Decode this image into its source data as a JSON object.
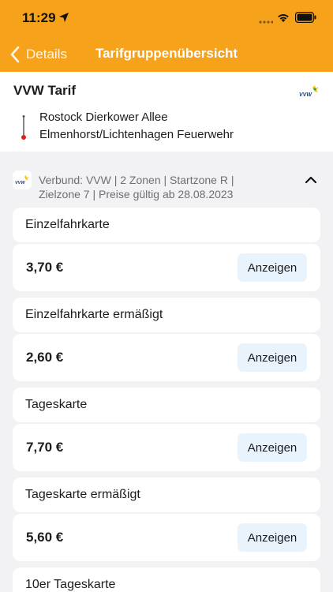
{
  "status_bar": {
    "time": "11:29"
  },
  "nav": {
    "back_label": "Details",
    "title": "Tarifgruppenübersicht"
  },
  "route": {
    "tarif_title": "VVW Tarif",
    "logo_text": "VVW",
    "from": "Rostock Dierkower Allee",
    "to": "Elmenhorst/Lichtenhagen Feuerwehr"
  },
  "group": {
    "info_line1": "Verbund: VVW |  2 Zonen |  Startzone R |",
    "info_line2": "Zielzone 7 |  Preise gültig ab 28.08.2023"
  },
  "tickets": [
    {
      "name": "Einzelfahrkarte",
      "price": "3,70 €",
      "button": "Anzeigen"
    },
    {
      "name": "Einzelfahrkarte ermäßigt",
      "price": "2,60 €",
      "button": "Anzeigen"
    },
    {
      "name": "Tageskarte",
      "price": "7,70 €",
      "button": "Anzeigen"
    },
    {
      "name": "Tageskarte ermäßigt",
      "price": "5,60 €",
      "button": "Anzeigen"
    },
    {
      "name": "10er Tageskarte"
    }
  ],
  "colors": {
    "brand_orange": "#f7a21b",
    "button_bg": "#e8f3fb"
  }
}
